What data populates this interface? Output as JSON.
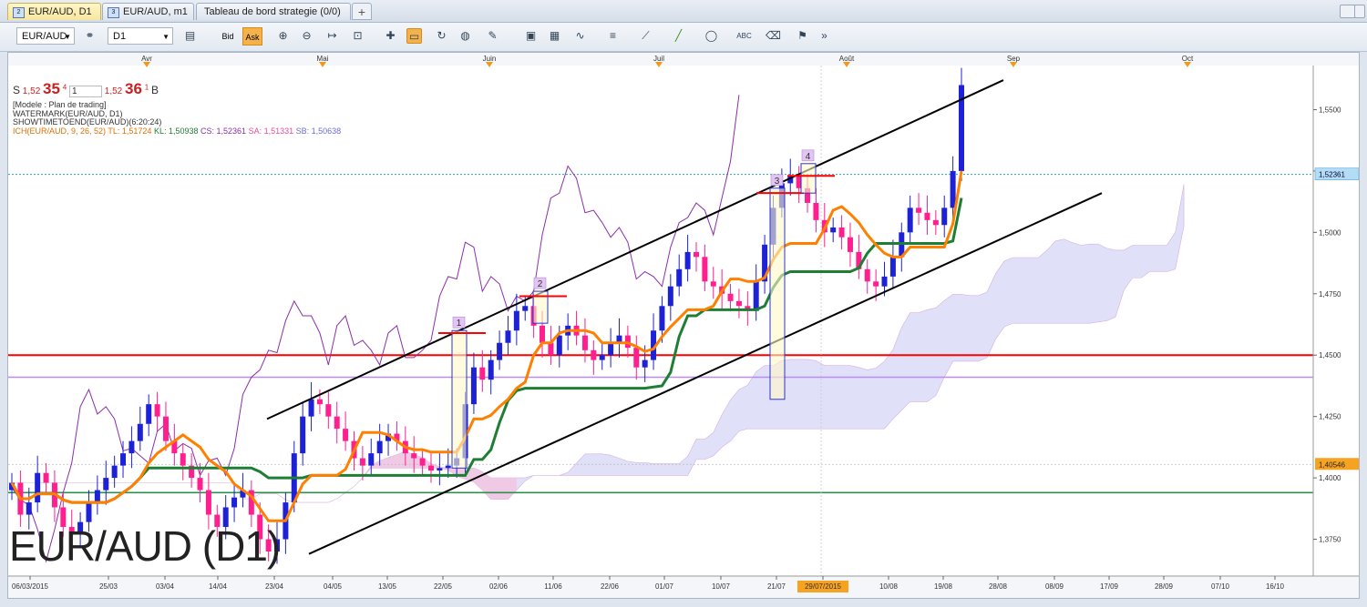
{
  "tabs": [
    {
      "label": "EUR/AUD, D1",
      "active": true,
      "icon": "2"
    },
    {
      "label": "EUR/AUD, m1",
      "active": false,
      "icon": "3"
    },
    {
      "label": "Tableau de bord strategie (0/0)",
      "active": false,
      "icon": ""
    }
  ],
  "toolbar": {
    "symbol": "EUR/AUD",
    "timeframe": "D1",
    "bid_label": "Bid",
    "ask_label": "Ask"
  },
  "quote": {
    "side_s": "S",
    "s_prefix": "1,52",
    "s_big": "35",
    "s_sup": "4",
    "lot": "1",
    "b_prefix": "1,52",
    "b_big": "36",
    "b_sup": "1",
    "side_b": "B"
  },
  "indicators": {
    "line1": "[Modele : Plan de trading]",
    "line2": "WATERMARK(EUR/AUD, D1)",
    "line3": "SHOWTIMETOEND(EUR/AUD)(6:20:24)",
    "ich": "ICH(EUR/AUD, 9, 26, 52)",
    "tl": "TL: 1,51724",
    "kl": "KL: 1,50938",
    "cs": "CS: 1,52361",
    "sa": "SA: 1,51331",
    "sb": "SB: 1,50638"
  },
  "watermark": "EUR/AUD (D1)",
  "colors": {
    "tenkan": "#ff8000",
    "kijun": "#1e7e34",
    "chikou": "#8b2fa8",
    "up_candle": "#1e22d6",
    "down_candle": "#ff1f8f",
    "cloud_up": "#f5c2dd",
    "cloud_down": "#c8c8f5",
    "support": "#ff0000",
    "current_price": "#1aa3d6"
  },
  "chart_data": {
    "type": "candlestick",
    "symbol": "EUR/AUD",
    "timeframe": "D1",
    "ylim": [
      1.36,
      1.565
    ],
    "y_ticks": [
      "1,5500",
      "1,5250",
      "1,5000",
      "1,4750",
      "1,4500",
      "1,4250",
      "1,4000",
      "1,3750"
    ],
    "x_ticks": [
      "06/03/2015",
      "25/03",
      "03/04",
      "14/04",
      "23/04",
      "04/05",
      "13/05",
      "22/05",
      "02/06",
      "11/06",
      "22/06",
      "01/07",
      "10/07",
      "21/07",
      "29/07/2015",
      "10/08",
      "19/08",
      "28/08",
      "08/09",
      "17/09",
      "28/09",
      "07/10",
      "16/10"
    ],
    "months": [
      "Avr",
      "Mai",
      "Juin",
      "Juil",
      "Août",
      "Sep",
      "Oct"
    ],
    "current_price": "1,52361",
    "marked_price": "1,40546",
    "highlighted_date": "29/07/2015",
    "horizontal_lines": [
      {
        "value": 1.45,
        "color": "#ff0000"
      },
      {
        "value": 1.441,
        "color": "#b98cf0"
      },
      {
        "value": 1.394,
        "color": "#2f8f4f"
      }
    ],
    "annotations": [
      "1",
      "2",
      "3",
      "4"
    ],
    "closes": [
      1.398,
      1.385,
      1.39,
      1.402,
      1.398,
      1.388,
      1.38,
      1.378,
      1.382,
      1.39,
      1.395,
      1.4,
      1.405,
      1.41,
      1.415,
      1.422,
      1.43,
      1.425,
      1.415,
      1.41,
      1.405,
      1.4,
      1.395,
      1.385,
      1.38,
      1.388,
      1.392,
      1.395,
      1.385,
      1.375,
      1.37,
      1.375,
      1.39,
      1.41,
      1.425,
      1.432,
      1.43,
      1.425,
      1.42,
      1.415,
      1.408,
      1.405,
      1.41,
      1.415,
      1.418,
      1.415,
      1.41,
      1.408,
      1.405,
      1.403,
      1.404,
      1.405,
      1.408,
      1.43,
      1.445,
      1.44,
      1.448,
      1.455,
      1.46,
      1.468,
      1.47,
      1.462,
      1.455,
      1.45,
      1.458,
      1.462,
      1.458,
      1.452,
      1.448,
      1.45,
      1.455,
      1.458,
      1.453,
      1.445,
      1.448,
      1.46,
      1.47,
      1.478,
      1.485,
      1.492,
      1.49,
      1.48,
      1.478,
      1.475,
      1.472,
      1.47,
      1.468,
      1.48,
      1.495,
      1.51,
      1.52,
      1.523,
      1.518,
      1.512,
      1.505,
      1.5,
      1.502,
      1.498,
      1.492,
      1.485,
      1.48,
      1.478,
      1.482,
      1.49,
      1.5,
      1.51,
      1.508,
      1.505,
      1.503,
      1.51,
      1.525,
      1.56
    ]
  }
}
